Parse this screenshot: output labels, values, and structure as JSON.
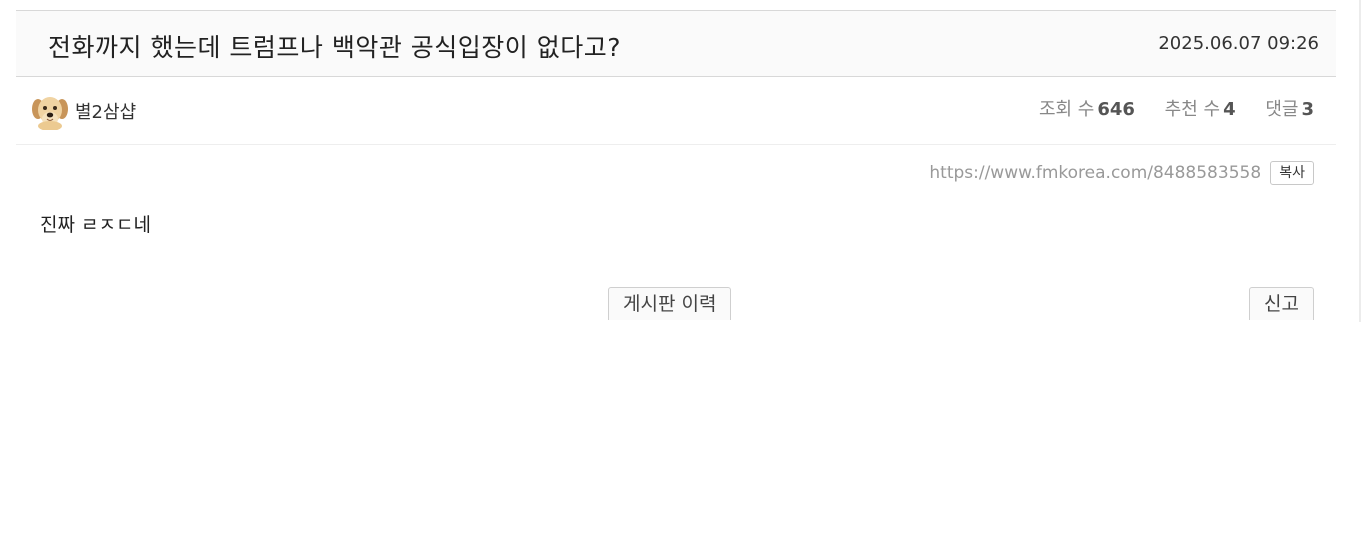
{
  "post": {
    "title": "전화까지 했는데 트럼프나 백악관 공식입장이 없다고?",
    "date": "2025.06.07 09:26",
    "author": {
      "name": "별2삼샵",
      "avatar_icon": "puppy-avatar-icon"
    },
    "stats": {
      "views_label": "조회 수",
      "views": "646",
      "recommend_label": "추천 수",
      "recommend": "4",
      "comments_label": "댓글",
      "comments": "3"
    },
    "url": "https://www.fmkorea.com/8488583558",
    "copy_label": "복사",
    "body": "진짜 ㄹㅈㄷ네",
    "history_label": "게시판 이력",
    "report_label": "신고"
  },
  "colors": {
    "title_bg": "#fafafa",
    "border": "#d8d8d8",
    "muted_text": "#888888",
    "url_text": "#999999"
  }
}
